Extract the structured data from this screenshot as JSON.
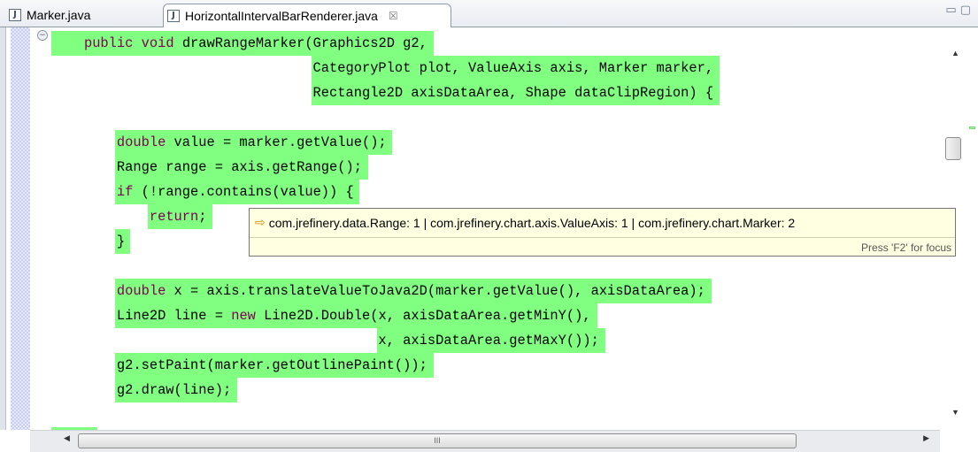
{
  "tabs": [
    {
      "label": "Marker.java",
      "icon": "java-file-icon",
      "active": false
    },
    {
      "label": "HorizontalIntervalBarRenderer.java",
      "icon": "java-file-icon",
      "active": true,
      "close": "☒"
    }
  ],
  "window_controls": {
    "minimize": "▭",
    "maximize": "▢"
  },
  "editor": {
    "highlight_color": "#80ff80",
    "keyword_color": "#7f0055",
    "lines": [
      {
        "text": "    public void drawRangeMarker(Graphics2D g2,",
        "highlighted": true
      },
      {
        "text": "                                CategoryPlot plot, ValueAxis axis, Marker marker,",
        "highlighted": true
      },
      {
        "text": "                                Rectangle2D axisDataArea, Shape dataClipRegion) {",
        "highlighted": true
      },
      {
        "text": "",
        "highlighted": false
      },
      {
        "text": "        double value = marker.getValue();",
        "highlighted": true
      },
      {
        "text": "        Range range = axis.getRange();",
        "highlighted": true
      },
      {
        "text": "        if (!range.contains(value)) {",
        "highlighted": true
      },
      {
        "text": "            return;",
        "highlighted": true
      },
      {
        "text": "        }",
        "highlighted": true
      },
      {
        "text": "",
        "highlighted": false
      },
      {
        "text": "        double x = axis.translateValueToJava2D(marker.getValue(), axisDataArea);",
        "highlighted": true
      },
      {
        "text": "        Line2D line = new Line2D.Double(x, axisDataArea.getMinY(),",
        "highlighted": true
      },
      {
        "text": "                                        x, axisDataArea.getMaxY());",
        "highlighted": true
      },
      {
        "text": "        g2.setPaint(marker.getOutlinePaint());",
        "highlighted": true
      },
      {
        "text": "        g2.draw(line);",
        "highlighted": true
      },
      {
        "text": "",
        "highlighted": false
      },
      {
        "text": "    }",
        "highlighted": true
      }
    ]
  },
  "popup": {
    "text": "com.jrefinery.data.Range: 1 | com.jrefinery.chart.axis.ValueAxis: 1 | com.jrefinery.chart.Marker: 2",
    "footer": "Press 'F2' for focus",
    "icon": "arrow-icon"
  },
  "scrollbars": {
    "up": "▲",
    "down": "▼",
    "left": "◀",
    "right": "▶",
    "grip": "III"
  }
}
